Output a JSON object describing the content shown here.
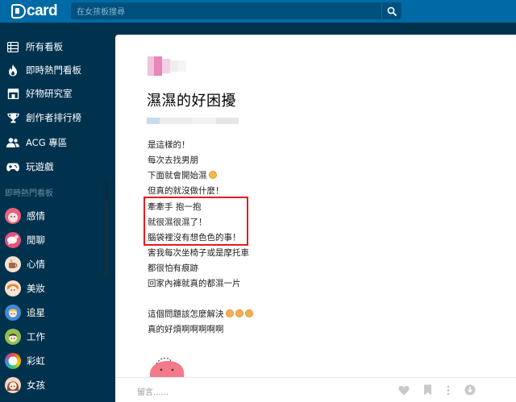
{
  "header": {
    "logo_text": "card",
    "search_placeholder": "在女孩板搜尋"
  },
  "sidebar": {
    "nav": [
      {
        "label": "所有看板",
        "icon": "list-icon"
      },
      {
        "label": "即時熱門看板",
        "icon": "fire-icon"
      },
      {
        "label": "好物研究室",
        "icon": "shop-icon"
      },
      {
        "label": "創作者排行榜",
        "icon": "trophy-icon"
      },
      {
        "label": "ACG 專區",
        "icon": "users-icon"
      },
      {
        "label": "玩遊戲",
        "icon": "gamepad-icon"
      }
    ],
    "section_title": "即時熱門看板",
    "boards": [
      {
        "label": "感情",
        "color": "#e9607a"
      },
      {
        "label": "閒聊",
        "color": "#e7507a"
      },
      {
        "label": "心情",
        "color": "#a06a4a"
      },
      {
        "label": "美妝",
        "color": "#f3c8a5"
      },
      {
        "label": "追星",
        "color": "#3f8ad6"
      },
      {
        "label": "工作",
        "color": "#8cc152"
      },
      {
        "label": "彩虹",
        "color": "#e55a9a"
      },
      {
        "label": "女孩",
        "color": "#c98a6a"
      }
    ]
  },
  "article": {
    "title": "濕濕的好困擾",
    "lines": [
      "是這樣的！",
      "每次去找男朋",
      "下面就會開始濕",
      "但真的就沒做什麼！",
      "牽牽手 抱一抱",
      "就很濕很濕了！",
      "腦袋裡沒有想色色的事！",
      "害我每次坐椅子或是摩托車",
      "都很怕有痕跡",
      "回家內褲就真的都濕一片",
      "",
      "這個問題該怎麼解決",
      "真的好煩啊啊啊啊啊"
    ],
    "comment_placeholder": "留言......"
  },
  "colors": {
    "topbar": "#006aa6",
    "sidebar": "#00324e",
    "highlight": "#e41c1c"
  }
}
